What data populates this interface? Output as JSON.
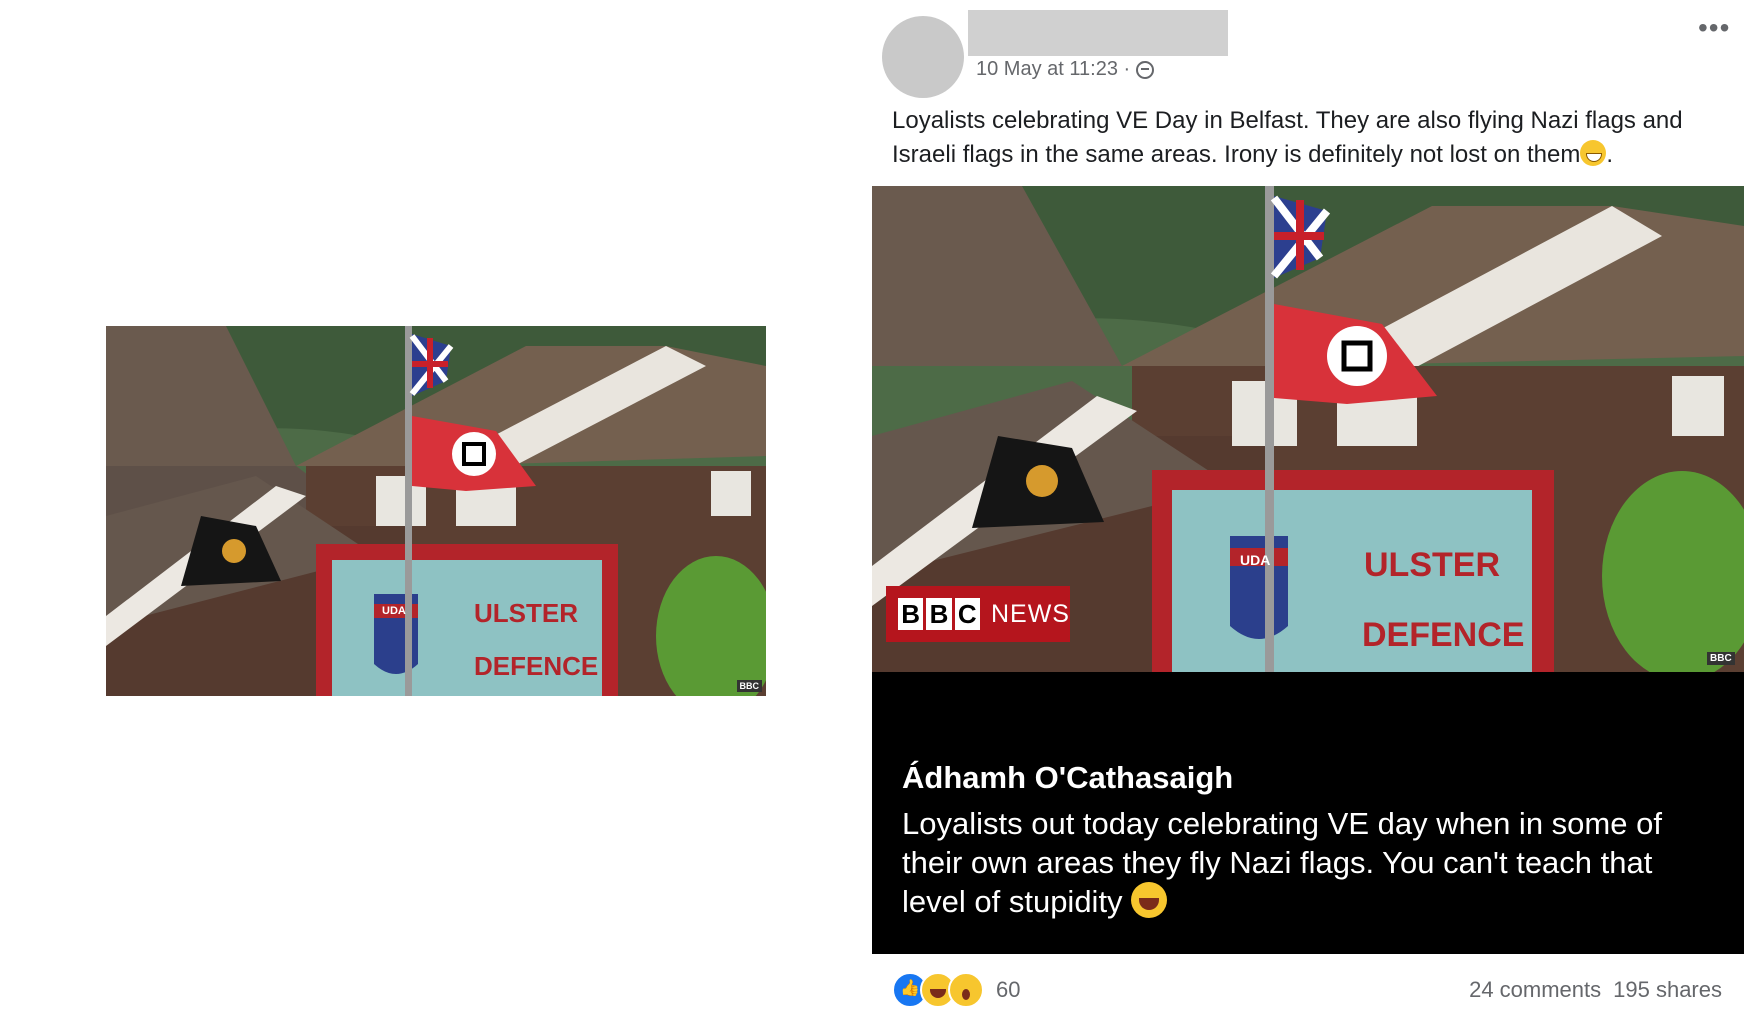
{
  "left_image": {
    "sign_line1": "ULSTER",
    "sign_line2": "DEFENCE",
    "crest_text": "UDA",
    "watermark": "BBC"
  },
  "post": {
    "timestamp": "10 May at 11:23 ·",
    "text": "Loyalists celebrating VE Day in Belfast. They are also flying Nazi flags and Israeli flags in the same areas. Irony is definitely not lost on them",
    "text_end": ".",
    "image": {
      "sign_line1": "ULSTER",
      "sign_line2": "DEFENCE",
      "crest_text": "UDA",
      "bbc_letters": [
        "B",
        "B",
        "C"
      ],
      "bbc_news": "NEWS",
      "watermark": "BBC",
      "caption_name": "Ádhamh O'Cathasaigh",
      "caption_text": "Loyalists out today celebrating VE day when in some of their own areas they fly Nazi flags. You can't teach that level of stupidity"
    },
    "reactions": {
      "icons": [
        "like-icon",
        "haha-icon",
        "wow-icon"
      ],
      "count": "60"
    },
    "comments": "24 comments",
    "shares": "195 shares"
  }
}
